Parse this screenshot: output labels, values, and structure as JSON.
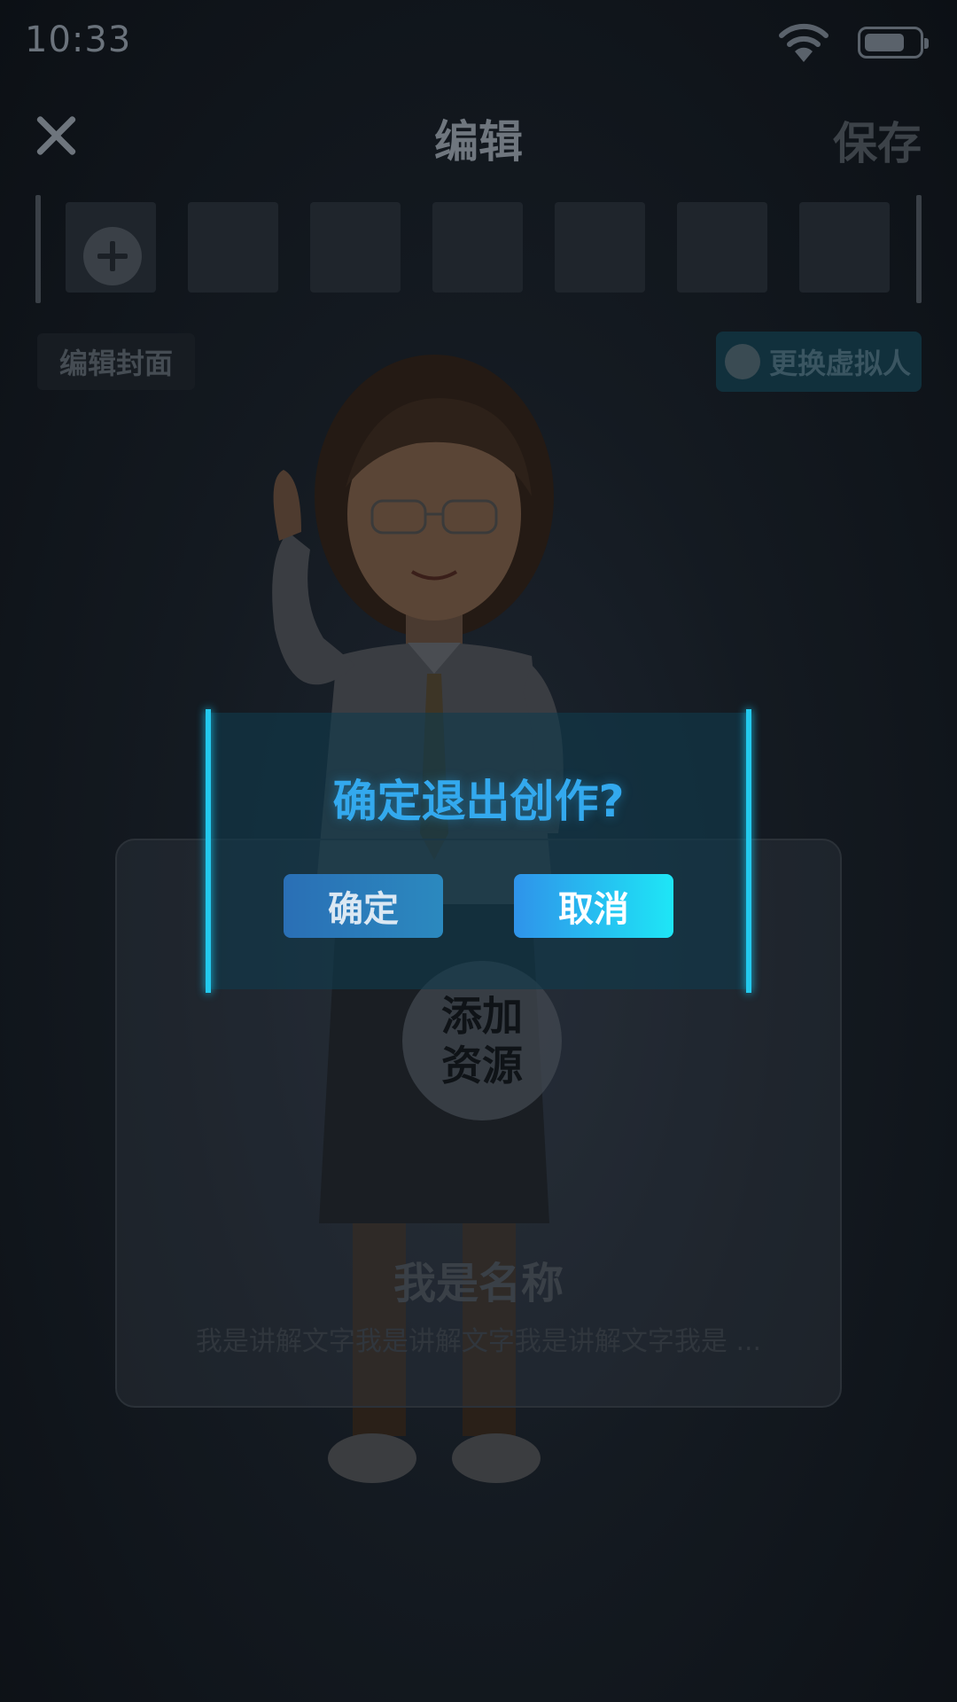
{
  "status_bar": {
    "time": "10:33"
  },
  "header": {
    "title": "编辑",
    "save_label": "保存"
  },
  "toolbar": {
    "edit_cover_label": "编辑封面",
    "swap_avatar_label": "更换虚拟人"
  },
  "resource_card": {
    "add_resource_label": "添加\n资源",
    "name": "我是名称",
    "description": "我是讲解文字我是讲解文字我是讲解文字我是 ..."
  },
  "dialog": {
    "title": "确定退出创作?",
    "confirm_label": "确定",
    "cancel_label": "取消"
  },
  "colors": {
    "accent_cyan": "#23c9ee",
    "dialog_title": "#33a9ee",
    "background": "#0e1318"
  }
}
